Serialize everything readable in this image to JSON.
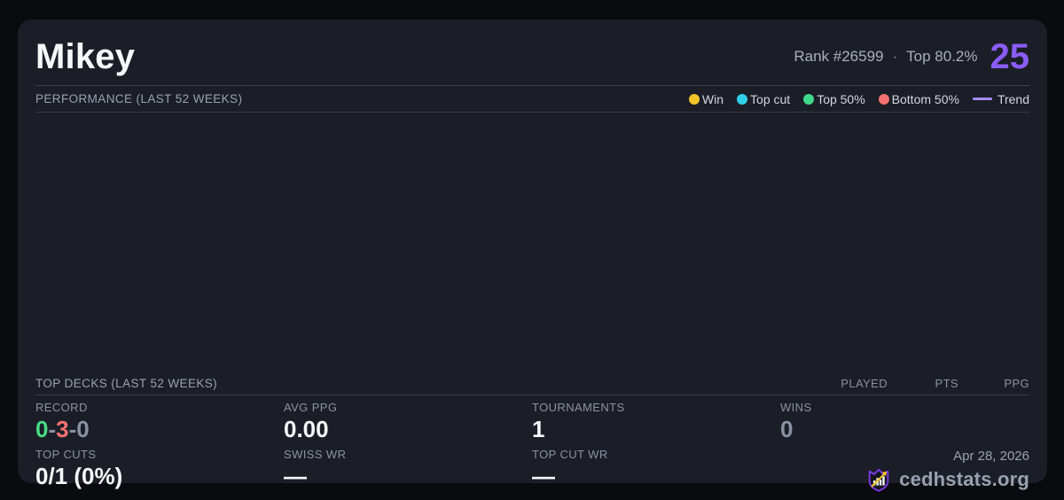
{
  "colors": {
    "page_bg": "#0a0b0e",
    "card_bg": "#1b1e27",
    "accent_purple": "#8b5cf6",
    "win_yellow": "#f0c429",
    "top_cut_cyan": "#2ed0e8",
    "top50_green": "#41d98b",
    "bottom50_red": "#f37070",
    "trend_purple": "#a78bfa",
    "record_win_green": "#49db84",
    "record_loss_red": "#f47171",
    "muted_gray": "#8b91a0"
  },
  "header": {
    "title": "Mikey",
    "rank": "Rank #26599",
    "dot_separator": "·",
    "top_percent": "Top 80.2%",
    "points": "25"
  },
  "performance": {
    "section_label": "PERFORMANCE (LAST 52 WEEKS)",
    "legend": [
      {
        "label": "Win",
        "color": "#f0c429",
        "swatch": "dot"
      },
      {
        "label": "Top cut",
        "color": "#2ed0e8",
        "swatch": "dot"
      },
      {
        "label": "Top 50%",
        "color": "#41d98b",
        "swatch": "dot"
      },
      {
        "label": "Bottom 50%",
        "color": "#f37070",
        "swatch": "dot"
      },
      {
        "label": "Trend",
        "color": "#a78bfa",
        "swatch": "line"
      }
    ],
    "chart_points": []
  },
  "top_decks": {
    "section_label": "TOP DECKS (LAST 52 WEEKS)",
    "columns": [
      "PLAYED",
      "PTS",
      "PPG"
    ],
    "rows": []
  },
  "stats": {
    "record": {
      "label": "RECORD",
      "wins": "0",
      "losses": "3",
      "draws": "0",
      "separator": "-"
    },
    "avg_ppg": {
      "label": "AVG PPG",
      "value": "0.00"
    },
    "tournaments": {
      "label": "TOURNAMENTS",
      "value": "1"
    },
    "wins": {
      "label": "WINS",
      "value": "0"
    },
    "top_cuts": {
      "label": "TOP CUTS",
      "value": "0/1 (0%)"
    },
    "swiss_wr": {
      "label": "SWISS WR",
      "value": "—"
    },
    "top_cut_wr": {
      "label": "TOP CUT WR",
      "value": "—"
    }
  },
  "footer": {
    "date": "Apr 28, 2026",
    "brand": "cedhstats.org"
  },
  "icons": {
    "brand_logo": "shield-crown-bar-chart-arrow-icon"
  }
}
